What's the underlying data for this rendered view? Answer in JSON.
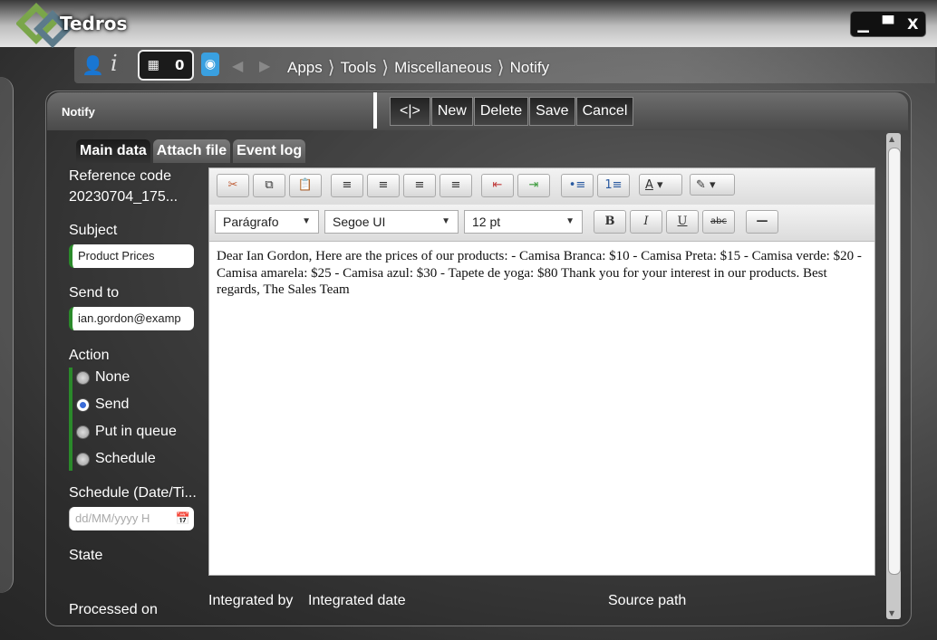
{
  "app": {
    "title": "Tedros"
  },
  "window_controls": {
    "minimize": "▁",
    "maximize": "▀",
    "close": "X"
  },
  "nav": {
    "notification_count": "0",
    "breadcrumbs": [
      "Apps",
      "Tools",
      "Miscellaneous",
      "Notify"
    ]
  },
  "panel": {
    "title": "Notify",
    "toolbar": {
      "toggle": "<|>",
      "new": "New",
      "delete": "Delete",
      "save": "Save",
      "cancel": "Cancel"
    }
  },
  "tabs": [
    "Main data",
    "Attach file",
    "Event log"
  ],
  "form": {
    "reference_label": "Reference code",
    "reference_value": "20230704_175...",
    "subject_label": "Subject",
    "subject_value": "Product Prices",
    "sendto_label": "Send to",
    "sendto_value": "ian.gordon@examp",
    "action_label": "Action",
    "action_options": [
      "None",
      "Send",
      "Put in queue",
      "Schedule"
    ],
    "action_selected": "Send",
    "schedule_label": "Schedule (Date/Ti...",
    "schedule_placeholder": "dd/MM/yyyy H",
    "state_label": "State",
    "processed_label": "Processed on"
  },
  "editor": {
    "paragraph": "Parágrafo",
    "font": "Segoe UI",
    "size": "12 pt",
    "content": "Dear Ian Gordon, Here are the prices of our products: - Camisa Branca: $10 - Camisa Preta: $15 - Camisa verde: $20 - Camisa amarela: $25 - Camisa azul: $30 - Tapete de yoga: $80 Thank you for your interest in our products. Best regards, The Sales Team"
  },
  "bottom": {
    "integrated_by": "Integrated by",
    "integrated_date": "Integrated date",
    "source_path": "Source path"
  }
}
